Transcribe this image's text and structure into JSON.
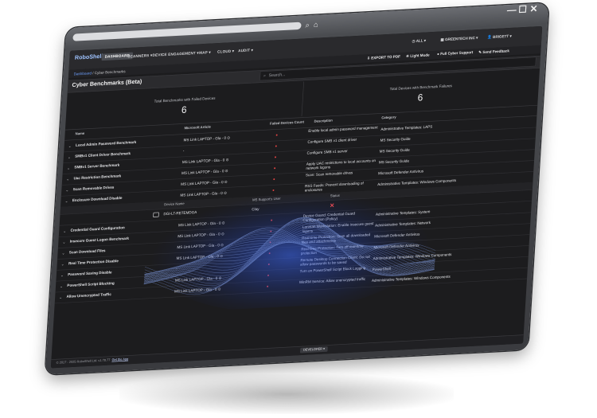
{
  "window": {
    "controls": [
      "—",
      "☐",
      "✕"
    ]
  },
  "browser": {
    "search_icon": "search-icon",
    "home_icon": "home-icon"
  },
  "nav": {
    "logo": "RoboShell",
    "logo_sub": "",
    "items": [
      {
        "label": "DASHBOARD",
        "active": true
      },
      {
        "label": "SCANNERS ▾"
      },
      {
        "label": "DEVICE ENGAGEMENT ▾"
      },
      {
        "label": "MAP ▾"
      },
      {
        "label": "CLOUD ▾"
      },
      {
        "label": "AUDIT ▾"
      }
    ],
    "right": {
      "all": "ALL ▾",
      "org": "GREENTECH INC ▾",
      "user": "BRIGETT ▾"
    }
  },
  "actions": {
    "export": "EXPORT TO PDF",
    "light": "Light Mode",
    "support": "Full Cyber Support",
    "feedback": "Send Feedback"
  },
  "breadcrumb": {
    "home": "Dashboard",
    "sep": "/",
    "current": "Cyber Benchmarks"
  },
  "page": {
    "title": "Cyber Benchmarks (Beta)",
    "search_placeholder": "Search..."
  },
  "stats": {
    "left": {
      "label": "Total Benchmarks with Failed Devices",
      "value": "6"
    },
    "right": {
      "label": "Total Devices with Benchmark Failures",
      "value": "6"
    }
  },
  "table": {
    "headers": [
      "Name",
      "Microsoft Article",
      "Failed Devices Count",
      "Description",
      "Category"
    ],
    "rows": [
      {
        "name": "Local Admin Password Benchmark",
        "article": "MS Link LAPTOP - Gla - 0 ⊙",
        "desc": "Enable local admin password management",
        "category": "Administrative Templates: LAPS"
      },
      {
        "name": "SMBv1 Client Driver Benchmark",
        "article": "-",
        "desc": "Configure SMB v1 client driver",
        "category": "MS Security Guide"
      },
      {
        "name": "SMBv1 Server Benchmark",
        "article": "MS Link LAPTOP - Gla - 0 ⊙",
        "desc": "Configure SMB v1 server",
        "category": "MS Security Guide"
      },
      {
        "name": "Uac Restriction Benchmark",
        "article": "MS Link LAPTOP - Gla - 0 ⊙",
        "desc": "Apply UAC restrictions to local accounts on network logons",
        "category": "MS Security Guide"
      },
      {
        "name": "Scan Removable Drives",
        "article": "MS Link LAPTOP - Gla - 0 ⊙",
        "desc": "Scan: Scan removable drives",
        "category": "Microsoft Defender Antivirus"
      },
      {
        "name": "Enclosure Download Disable",
        "article": "MS Link LAPTOP - Gla - 0 ⊙",
        "desc": "RSS Feeds: Prevent downloading of enclosures",
        "category": "Administrative Templates: Windows Components"
      }
    ],
    "sub": {
      "headers": [
        "Device Name",
        "MS Support's User",
        "Status"
      ],
      "device": "DGI-LT-RETEMDGA",
      "user": "Clay"
    },
    "rows2": [
      {
        "name": "Credential Guard Configuration",
        "article": "MS Link LAPTOP - Gla - 0 ⊙",
        "desc": "Device Guard: Credential Guard Configuration (Policy)",
        "category": "Administrative Templates: System"
      },
      {
        "name": "Insecure Guest Logon Benchmark",
        "article": "MS Link LAPTOP - Gla - 0 ⊙",
        "desc": "Lanman Workstation: Enable insecure guest logons",
        "category": "Administrative Templates: Network"
      },
      {
        "name": "Scan Download Files",
        "article": "MS Link LAPTOP - Gla - 0 ⊙",
        "desc": "Real-time Protection: Scan all downloaded files and attachments",
        "category": "Microsoft Defender Antivirus"
      },
      {
        "name": "Real Time Protection Disable",
        "article": "MS Link LAPTOP - Gla - 0 ⊙",
        "desc": "Real-time Protection: Turn off real-time protection",
        "category": "Microsoft Defender Antivirus"
      },
      {
        "name": "Password Saving Disable",
        "article": "-",
        "desc": "Remote Desktop Connection Client: Do not allow passwords to be saved",
        "category": "Administrative Templates: Windows Components"
      },
      {
        "name": "PowerShell Script Blocking",
        "article": "MS Link LAPTOP - Gla - 0 ⊙",
        "desc": "Turn on PowerShell Script Block Logging",
        "category": "PowerShell"
      },
      {
        "name": "Allow Unencrypted Traffic",
        "article": "MS Link LAPTOP - Gla - 0 ⊙",
        "desc": "WinRM Service: Allow unencrypted traffic",
        "category": "Administrative Templates: Windows Components"
      }
    ]
  },
  "footer": {
    "copyright": "© 2017 - 2025 RoboShell Ltd. v1.78.77",
    "link": "Get the App",
    "dev": "DEVELOPER ▾"
  }
}
